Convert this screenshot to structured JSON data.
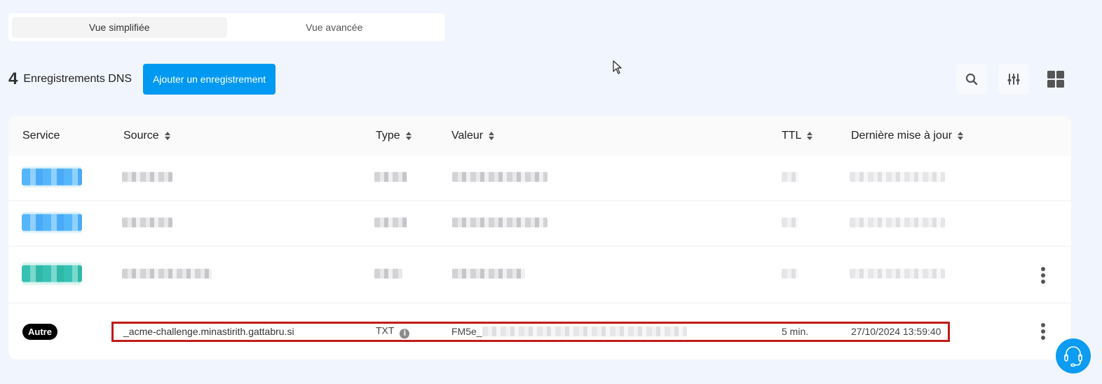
{
  "view_toggle": {
    "options": [
      {
        "label": "Vue simplifiée",
        "active": true
      },
      {
        "label": "Vue avancée",
        "active": false
      }
    ]
  },
  "toolbar": {
    "count": "4",
    "count_label": "Enregistrements DNS",
    "add_button": "Ajouter un enregistrement",
    "icons": [
      "search-icon",
      "filter-sliders-icon",
      "grid-view-icon"
    ]
  },
  "table": {
    "columns": [
      {
        "label": "Service",
        "sortable": false
      },
      {
        "label": "Source",
        "sortable": true
      },
      {
        "label": "Type",
        "sortable": true
      },
      {
        "label": "Valeur",
        "sortable": true
      },
      {
        "label": "TTL",
        "sortable": true
      },
      {
        "label": "Dernière mise à jour",
        "sortable": true
      }
    ],
    "rows": [
      {
        "service": "[redacted]",
        "service_color": "#55b6fb",
        "source": "[redacted]",
        "type": "[redacted]",
        "value": "[redacted]",
        "ttl": "[redacted]",
        "updated": "[redacted]",
        "has_menu": false
      },
      {
        "service": "[redacted]",
        "service_color": "#55b6fb",
        "source": "[redacted]",
        "type": "[redacted]",
        "value": "[redacted]",
        "ttl": "[redacted]",
        "updated": "[redacted]",
        "has_menu": false
      },
      {
        "service": "[redacted]",
        "service_color": "#36c1b3",
        "source": "[redacted]",
        "type": "[redacted]",
        "value": "[redacted]",
        "ttl": "[redacted]",
        "updated": "[redacted]",
        "has_menu": true
      },
      {
        "service": "Autre",
        "source": "_acme-challenge.minastirith.gattabru.si",
        "type": "TXT",
        "value_prefix": "FM5e_",
        "value_rest": "[redacted]",
        "ttl": "5 min.",
        "updated": "27/10/2024 13:59:40",
        "has_menu": true,
        "highlighted": true
      }
    ]
  },
  "colors": {
    "accent": "#0099f2",
    "highlight": "#c21a1a",
    "background": "#f1f5fd"
  },
  "support_button": {
    "icon": "headset-icon"
  }
}
